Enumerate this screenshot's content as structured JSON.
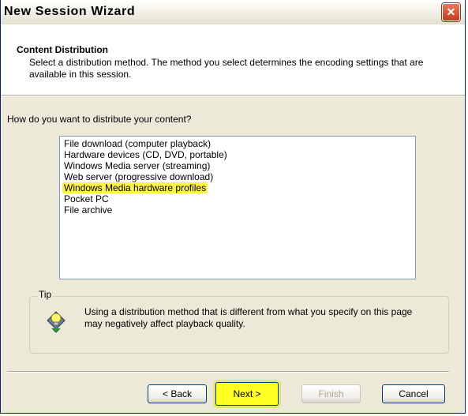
{
  "window": {
    "title": "New Session Wizard"
  },
  "header": {
    "title": "Content Distribution",
    "description": "Select a distribution method. The method you select determines the encoding settings that are available in this session."
  },
  "question": "How do you want to distribute your content?",
  "distribution_list": {
    "items": [
      "File download (computer playback)",
      "Hardware devices (CD, DVD, portable)",
      "Windows Media server (streaming)",
      "Web server (progressive download)",
      "Windows Media hardware profiles",
      "Pocket PC",
      "File archive"
    ],
    "selected": "Windows Media hardware profiles"
  },
  "tip": {
    "legend": "Tip",
    "text": "Using a distribution method that is different from what you specify on this page may negatively affect playback quality.",
    "icon": "lightbulb-icon"
  },
  "buttons": {
    "back": "< Back",
    "next": "Next >",
    "finish": "Finish",
    "cancel": "Cancel"
  },
  "colors": {
    "highlight": "#fff34d",
    "dialog_bg": "#ece9d8",
    "close_button": "#c6381b"
  }
}
